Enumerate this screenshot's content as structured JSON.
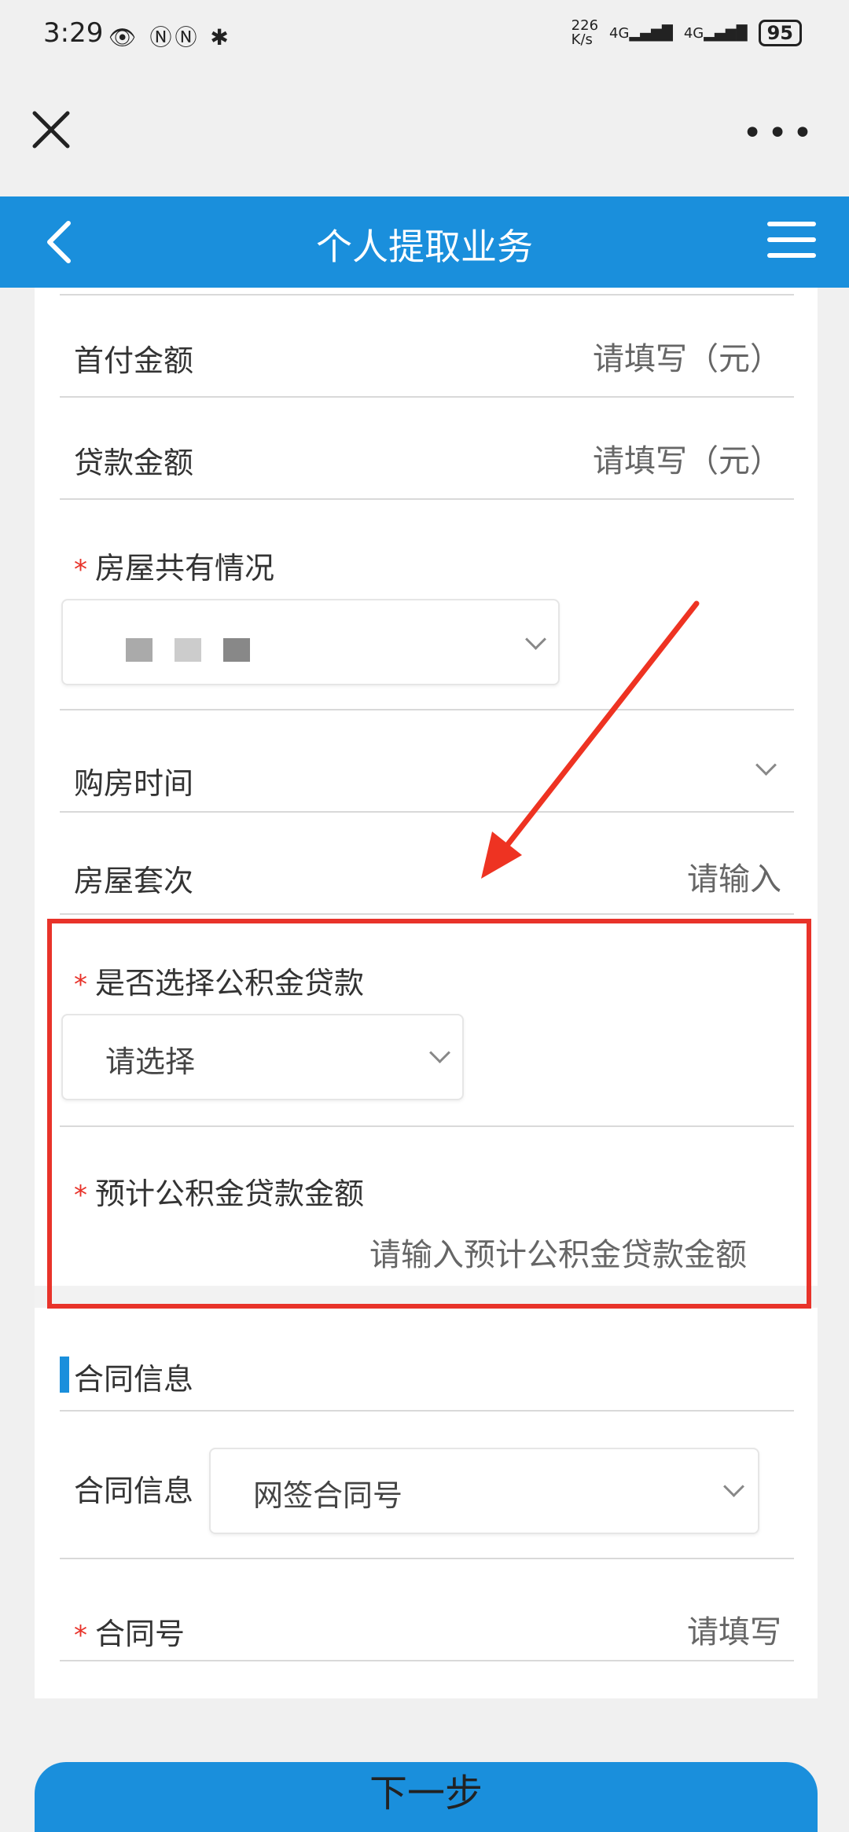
{
  "status_bar": {
    "time": "3:29",
    "icons": "👁 ⓃⓃ ✱",
    "net_speed_top": "226",
    "net_speed_bottom": "K/s",
    "signal1": "4G",
    "signal2": "4G",
    "battery": "95"
  },
  "header": {
    "title": "个人提取业务"
  },
  "form": {
    "down_payment": {
      "label": "首付金额",
      "placeholder": "请填写（元）"
    },
    "loan_amount": {
      "label": "贷款金额",
      "placeholder": "请填写（元）"
    },
    "co_ownership": {
      "label": "房屋共有情况"
    },
    "purchase_time": {
      "label": "购房时间"
    },
    "house_count": {
      "label": "房屋套次",
      "placeholder": "请输入"
    },
    "use_fund_loan": {
      "label": "是否选择公积金贷款",
      "value": "请选择"
    },
    "expected_fund_loan": {
      "label": "预计公积金贷款金额",
      "placeholder": "请输入预计公积金贷款金额"
    }
  },
  "contract_section": {
    "title": "合同信息",
    "contract_info": {
      "label": "合同信息",
      "value": "网签合同号"
    },
    "contract_no": {
      "label": "合同号",
      "placeholder": "请填写"
    }
  },
  "next_button": "下一步",
  "colors": {
    "brand": "#1a8fdc",
    "required": "#e8332a",
    "highlight": "#e8332a"
  }
}
